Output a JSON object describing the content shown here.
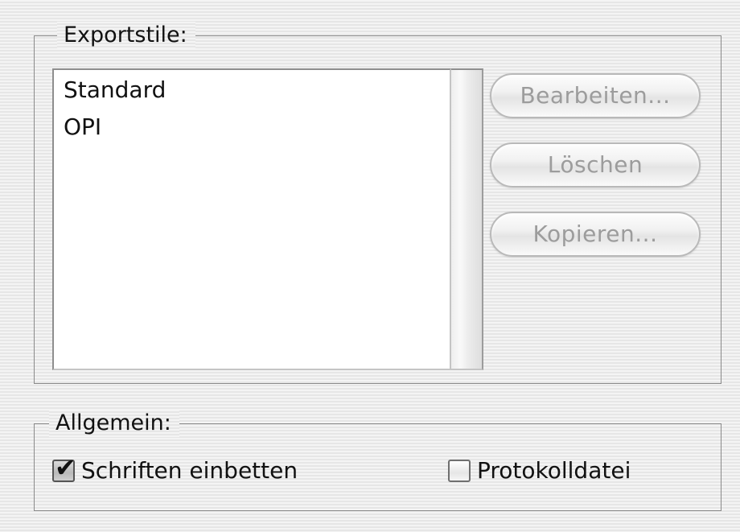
{
  "export_styles": {
    "title": "Exportstile:",
    "items": [
      "Standard",
      "OPI"
    ],
    "buttons": {
      "edit": "Bearbeiten...",
      "delete": "Löschen",
      "copy": "Kopieren..."
    },
    "buttons_enabled": false
  },
  "general": {
    "title": "Allgemein:",
    "embed_fonts": {
      "label": "Schriften einbetten",
      "checked": true
    },
    "log_file": {
      "label": "Protokolldatei",
      "checked": false
    }
  },
  "icons": {
    "checkmark": "checkmark-icon"
  },
  "colors": {
    "disabled_text": "#9c9c9c",
    "border": "#8a8a8a",
    "list_background": "#ffffff"
  }
}
